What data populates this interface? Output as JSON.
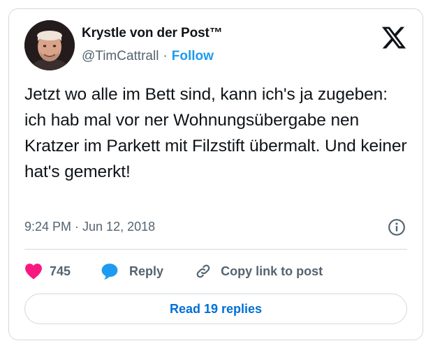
{
  "author": {
    "name": "Krystle von der Post™",
    "handle": "@TimCattrall",
    "separator": "·",
    "follow_label": "Follow"
  },
  "tweet": {
    "text": "Jetzt wo alle im Bett sind, kann ich's ja zugeben: ich hab mal vor ner Wohnungsübergabe nen Kratzer im Parkett mit Filzstift übermalt. Und keiner hat's gemerkt!",
    "timestamp": "9:24 PM · Jun 12, 2018"
  },
  "actions": {
    "like_count": "745",
    "reply_label": "Reply",
    "copy_link_label": "Copy link to post"
  },
  "read_replies_label": "Read 19 replies",
  "icons": {
    "brand": "x-logo-icon",
    "info": "info-icon",
    "like": "heart-icon",
    "reply": "speech-bubble-icon",
    "copy": "link-icon"
  },
  "colors": {
    "heart": "#f91880",
    "reply": "#1d9bf0",
    "link_blue": "#006fd6",
    "follow_blue": "#1d9bf0",
    "secondary_text": "#536471"
  }
}
